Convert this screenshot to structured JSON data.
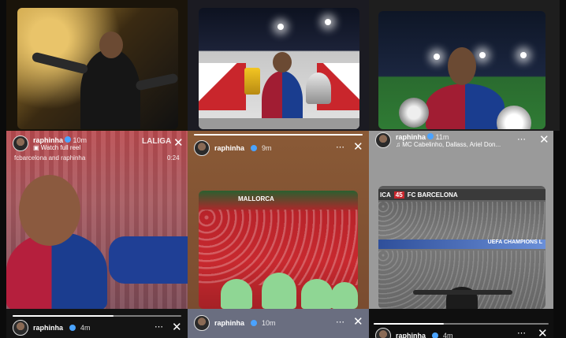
{
  "tiles": {
    "t4": {
      "username": "raphinha",
      "time": "10m",
      "sub": "Watch full reel",
      "caption": "fcbarcelona and raphinha",
      "duration": "0:24",
      "watermark": "LALIGA"
    },
    "t5": {
      "username": "raphinha",
      "time": "9m",
      "stadium_sign": "MALLORCA"
    },
    "t6": {
      "username": "raphinha",
      "time": "11m",
      "music": "MC Cabelinho, Dallass, Ariel Don...",
      "banner_left": "ICA",
      "banner_num": "45",
      "banner_right": "FC BARCELONA",
      "ad_board": "UEFA CHAMPIONS L"
    },
    "b1": {
      "username": "raphinha",
      "time": "4m"
    },
    "b2": {
      "username": "raphinha",
      "time": "10m"
    },
    "b3": {
      "username": "raphinha",
      "time": "4m"
    }
  },
  "icons": {
    "more": "⋯",
    "close": "✕",
    "music": "♫",
    "mute": "♪"
  }
}
